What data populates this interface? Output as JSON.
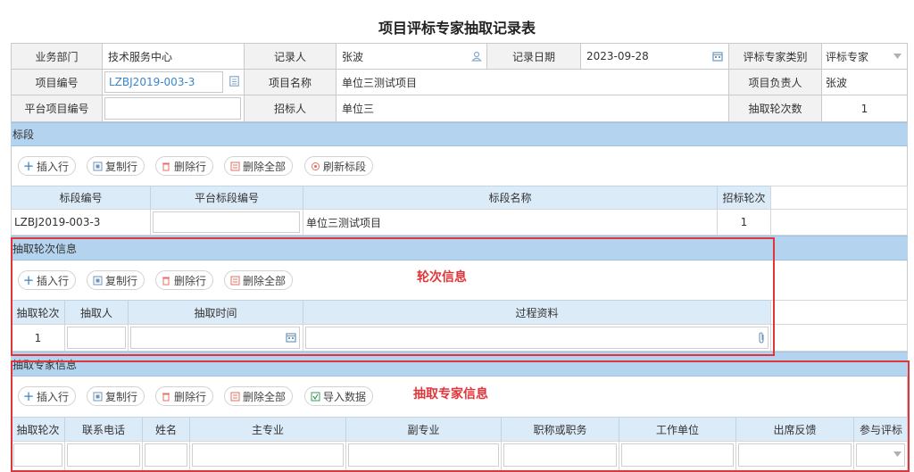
{
  "page_title": "项目评标专家抽取记录表",
  "form": {
    "dept_label": "业务部门",
    "dept_value": "技术服务中心",
    "recorder_label": "记录人",
    "recorder_value": "张波",
    "date_label": "记录日期",
    "date_value": "2023-09-28",
    "category_label": "评标专家类别",
    "category_value": "评标专家",
    "project_no_label": "项目编号",
    "project_no_value": "LZBJ2019-003-3",
    "project_name_label": "项目名称",
    "project_name_value": "单位三测试项目",
    "owner_label": "项目负责人",
    "owner_value": "张波",
    "platform_no_label": "平台项目编号",
    "platform_no_value": "",
    "tenderer_label": "招标人",
    "tenderer_value": "单位三",
    "rounds_label": "抽取轮次数",
    "rounds_value": "1"
  },
  "buttons": {
    "insert": "插入行",
    "copy": "复制行",
    "delete": "删除行",
    "delete_all": "删除全部",
    "refresh_section": "刷新标段",
    "import": "导入数据"
  },
  "section_bid": {
    "title": "标段",
    "headers": [
      "标段编号",
      "平台标段编号",
      "标段名称",
      "招标轮次"
    ],
    "row": {
      "code": "LZBJ2019-003-3",
      "platform_code": "",
      "name": "单位三测试项目",
      "round": "1"
    }
  },
  "section_round": {
    "title": "抽取轮次信息",
    "annotation": "轮次信息",
    "headers": [
      "抽取轮次",
      "抽取人",
      "抽取时间",
      "过程资料"
    ],
    "row": {
      "round": "1",
      "person": "",
      "time": "",
      "material": ""
    }
  },
  "section_expert": {
    "title": "抽取专家信息",
    "annotation": "抽取专家信息",
    "headers": [
      "抽取轮次",
      "联系电话",
      "姓名",
      "主专业",
      "副专业",
      "职称或职务",
      "工作单位",
      "出席反馈",
      "参与评标"
    ]
  },
  "colors": {
    "section_bar": "#b4d3ee",
    "table_header": "#dcebf8",
    "required_field": "#fcefd8",
    "annotation_red": "#e0353a",
    "link_blue": "#3a86c8"
  }
}
